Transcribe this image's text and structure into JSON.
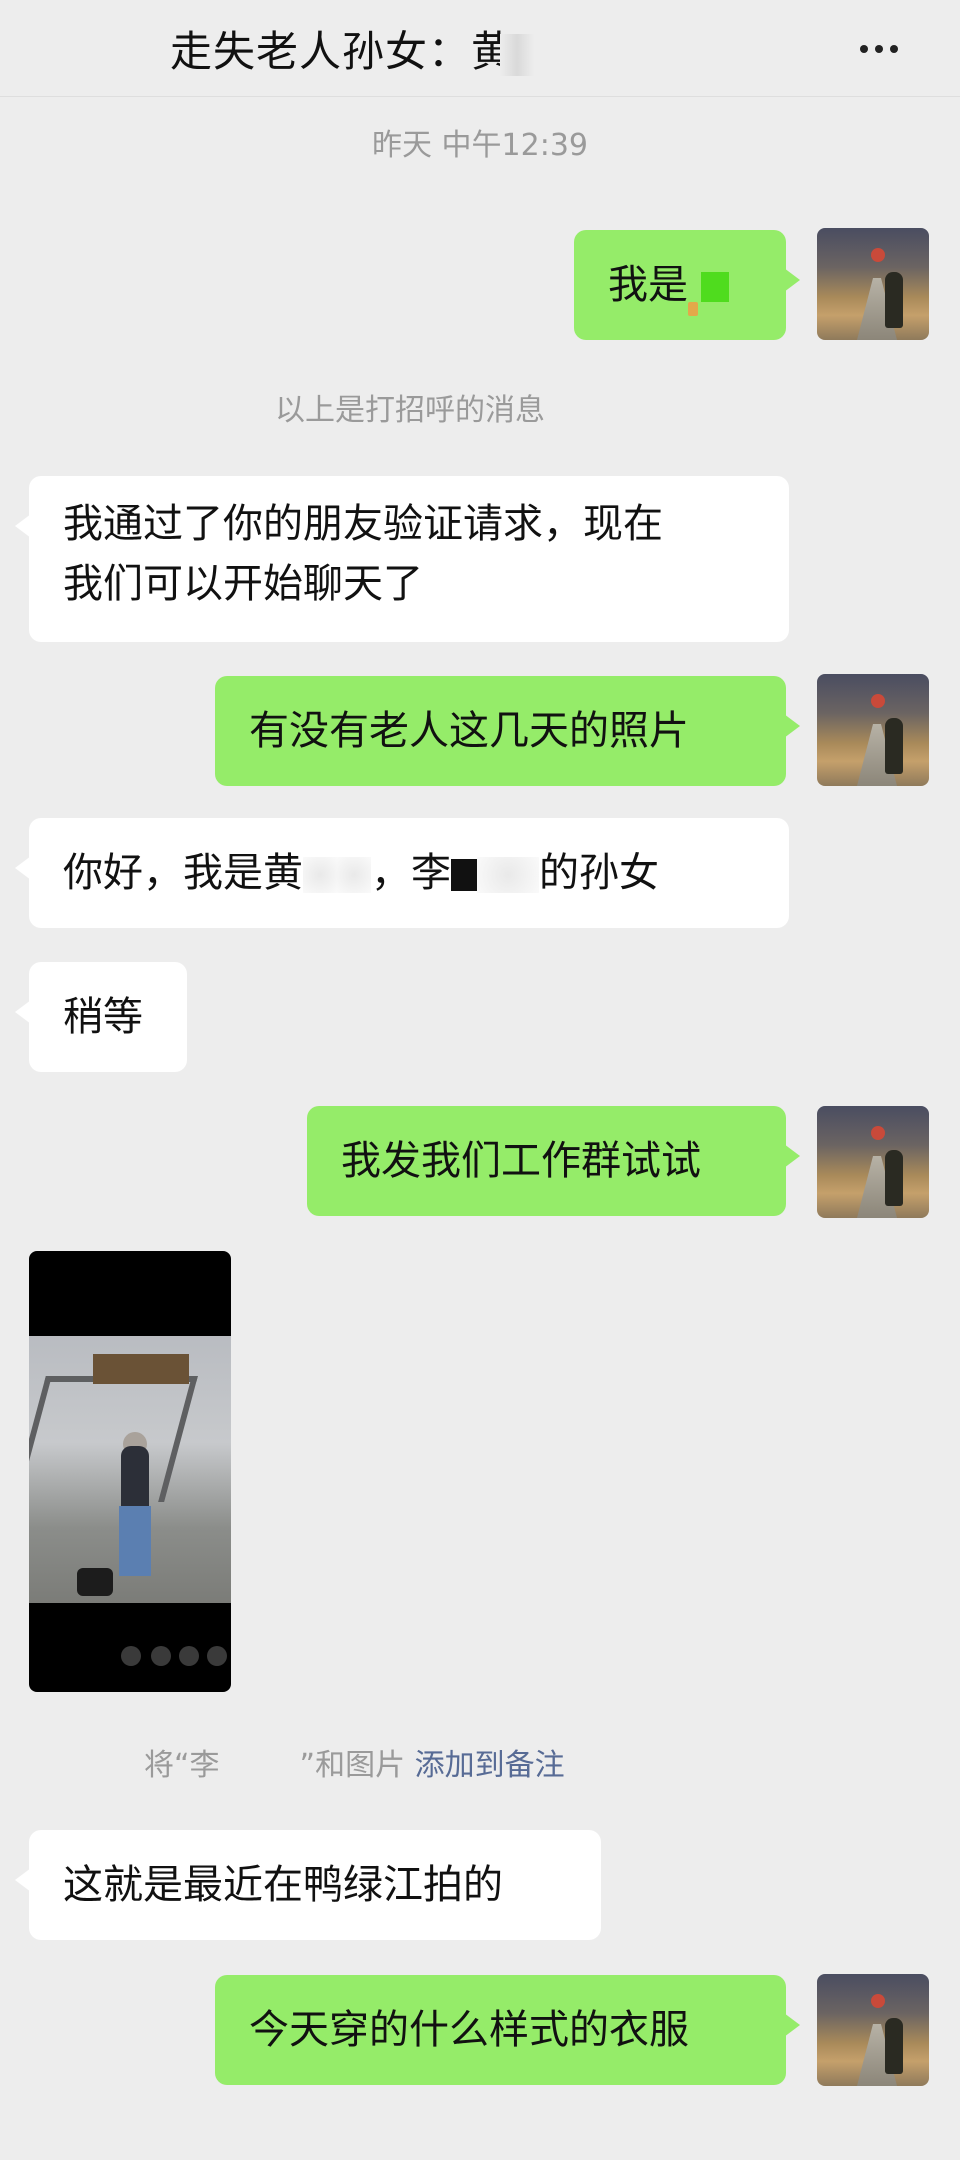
{
  "header": {
    "title": "走失老人孙女：黄",
    "more_icon": "more-dots-icon"
  },
  "timestamp": "昨天 中午12:39",
  "greeting_notice": "以上是打招呼的消息",
  "messages": [
    {
      "side": "right",
      "text_before": "我是",
      "masked": true
    },
    {
      "side": "left",
      "line1": "我通过了你的朋友验证请求，现在",
      "line2": "我们可以开始聊天了"
    },
    {
      "side": "right",
      "text": "有没有老人这几天的照片"
    },
    {
      "side": "left",
      "part1": "你好，我是黄",
      "part2": "，李",
      "part3": "的孙女"
    },
    {
      "side": "left",
      "text": "稍等"
    },
    {
      "side": "right",
      "text": "我发我们工作群试试"
    },
    {
      "side": "left",
      "text": "这就是最近在鸭绿江拍的"
    },
    {
      "side": "right",
      "text": "今天穿的什么样式的衣服"
    }
  ],
  "remark_notice": {
    "prefix": "将“李",
    "suffix": "”和图片",
    "link": "添加到备注"
  },
  "colors": {
    "background": "#ededed",
    "self_bubble": "#95ec69",
    "other_bubble": "#ffffff",
    "link": "#576b95"
  }
}
